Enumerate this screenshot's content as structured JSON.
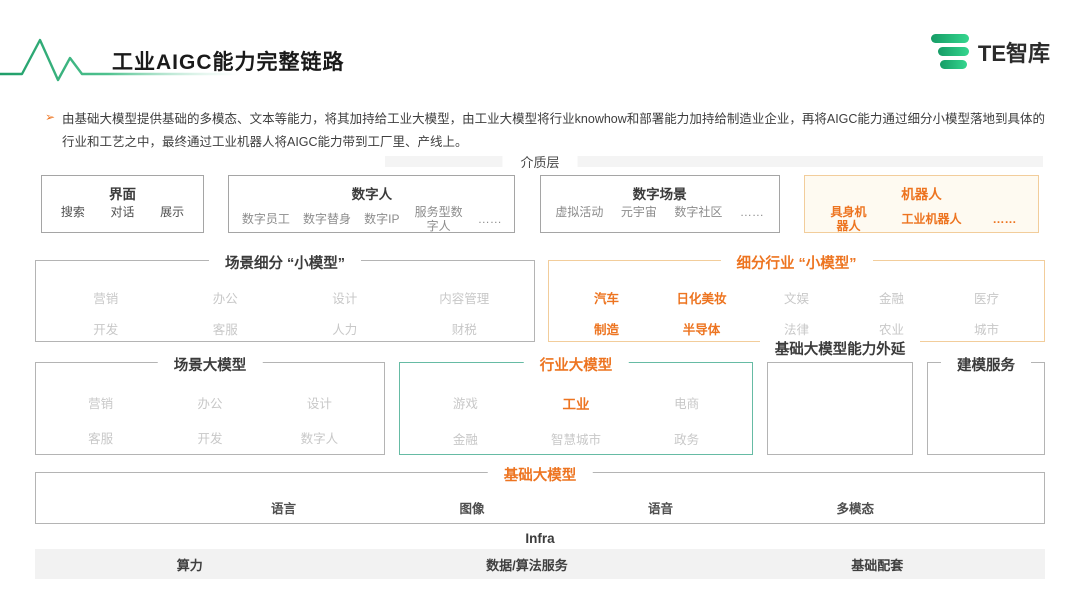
{
  "colors": {
    "accent_orange": "#ED7420",
    "teal_border": "#66BBA4",
    "orange_border": "#F2CD9B",
    "cream_background": "#FEFAF1",
    "logo_green": "#2BC47E",
    "infra_bar_bg": "#F2F2F2"
  },
  "header": {
    "title": "工业AIGC能力完整链路",
    "logo_text": "TE智库"
  },
  "intro": {
    "bullet": "➢",
    "text": "由基础大模型提供基础的多模态、文本等能力，将其加持给工业大模型，由工业大模型将行业knowhow和部署能力加持给制造业企业，再将AIGC能力通过细分小模型落地到具体的行业和工艺之中，最终通过工业机器人将AIGC能力带到工厂里、产线上。"
  },
  "diagram": {
    "medium_layer_label": "介质层",
    "rows": [
      {
        "id": "media",
        "boxes": [
          {
            "id": "interface",
            "title": "界面",
            "title_tone": "dark",
            "title_pos": "inside",
            "style": "gray",
            "items": [
              {
                "label": "搜索",
                "tone": "dark"
              },
              {
                "label": "对话",
                "tone": "dark"
              },
              {
                "label": "展示",
                "tone": "dark"
              }
            ]
          },
          {
            "id": "digital-human",
            "title": "数字人",
            "title_tone": "dark",
            "title_pos": "inside",
            "style": "gray",
            "items": [
              {
                "label": "数字员工",
                "tone": "mid"
              },
              {
                "label": "数字替身",
                "tone": "mid"
              },
              {
                "label": "数字IP",
                "tone": "mid"
              },
              {
                "label": "服务型数字人",
                "tone": "mid"
              },
              {
                "label": "……",
                "tone": "mid"
              }
            ]
          },
          {
            "id": "digital-scene",
            "title": "数字场景",
            "title_tone": "dark",
            "title_pos": "inside",
            "style": "gray",
            "items": [
              {
                "label": "虚拟活动",
                "tone": "mid"
              },
              {
                "label": "元宇宙",
                "tone": "mid"
              },
              {
                "label": "数字社区",
                "tone": "mid"
              },
              {
                "label": "……",
                "tone": "mid"
              }
            ]
          },
          {
            "id": "robot",
            "title": "机器人",
            "title_tone": "orange",
            "title_pos": "inside",
            "style": "orange",
            "items": [
              {
                "label": "具身机器人",
                "tone": "orange"
              },
              {
                "label": "工业机器人",
                "tone": "orange"
              },
              {
                "label": "……",
                "tone": "orange"
              }
            ]
          }
        ]
      },
      {
        "id": "small-models",
        "boxes": [
          {
            "id": "scene-small",
            "title": "场景细分 “小模型”",
            "title_tone": "dark",
            "title_pos": "border",
            "style": "gray-light",
            "cols": 4,
            "items": [
              {
                "label": "营销",
                "tone": "light"
              },
              {
                "label": "办公",
                "tone": "light"
              },
              {
                "label": "设计",
                "tone": "light"
              },
              {
                "label": "内容管理",
                "tone": "light"
              },
              {
                "label": "开发",
                "tone": "light"
              },
              {
                "label": "客服",
                "tone": "light"
              },
              {
                "label": "人力",
                "tone": "light"
              },
              {
                "label": "财税",
                "tone": "light"
              }
            ]
          },
          {
            "id": "industry-small",
            "title": "细分行业 “小模型”",
            "title_tone": "orange",
            "title_pos": "border",
            "style": "orange-line",
            "cols": 5,
            "items": [
              {
                "label": "汽车",
                "tone": "orange"
              },
              {
                "label": "日化美妆",
                "tone": "orange"
              },
              {
                "label": "文娱",
                "tone": "light"
              },
              {
                "label": "金融",
                "tone": "light"
              },
              {
                "label": "医疗",
                "tone": "light"
              },
              {
                "label": "制造",
                "tone": "orange"
              },
              {
                "label": "半导体",
                "tone": "orange"
              },
              {
                "label": "法律",
                "tone": "light"
              },
              {
                "label": "农业",
                "tone": "light"
              },
              {
                "label": "城市",
                "tone": "light"
              }
            ]
          }
        ]
      },
      {
        "id": "large-models",
        "boxes": [
          {
            "id": "scene-large",
            "title": "场景大模型",
            "title_tone": "dark",
            "title_pos": "border",
            "style": "gray-light",
            "cols": 3,
            "items": [
              {
                "label": "营销",
                "tone": "light"
              },
              {
                "label": "办公",
                "tone": "light"
              },
              {
                "label": "设计",
                "tone": "light"
              },
              {
                "label": "客服",
                "tone": "light"
              },
              {
                "label": "开发",
                "tone": "light"
              },
              {
                "label": "数字人",
                "tone": "light"
              }
            ]
          },
          {
            "id": "industry-large",
            "title": "行业大模型",
            "title_tone": "orange",
            "title_pos": "border",
            "style": "teal",
            "cols": 3,
            "items": [
              {
                "label": "游戏",
                "tone": "light"
              },
              {
                "label": "工业",
                "tone": "orange-bold"
              },
              {
                "label": "电商",
                "tone": "light"
              },
              {
                "label": "金融",
                "tone": "light"
              },
              {
                "label": "智慧城市",
                "tone": "light"
              },
              {
                "label": "政务",
                "tone": "light"
              }
            ]
          },
          {
            "id": "foundation-ext",
            "title": "基础大模型能力外延",
            "title_tone": "dark",
            "title_pos": "border",
            "style": "gray-light",
            "items": []
          },
          {
            "id": "modeling",
            "title": "建模服务",
            "title_tone": "dark",
            "title_pos": "border",
            "style": "gray-light",
            "items": []
          }
        ]
      },
      {
        "id": "foundation",
        "boxes": [
          {
            "id": "foundation-model",
            "title": "基础大模型",
            "title_tone": "orange",
            "title_pos": "border",
            "style": "gray-light",
            "items": [
              {
                "label": "语言",
                "tone": "dark"
              },
              {
                "label": "图像",
                "tone": "dark"
              },
              {
                "label": "语音",
                "tone": "dark"
              },
              {
                "label": "多模态",
                "tone": "dark"
              }
            ]
          }
        ]
      }
    ],
    "infra": {
      "label": "Infra",
      "items": [
        {
          "label": "算力",
          "tone": "dark"
        },
        {
          "label": "数据/算法服务",
          "tone": "dark"
        },
        {
          "label": "基础配套",
          "tone": "dark"
        }
      ]
    }
  }
}
